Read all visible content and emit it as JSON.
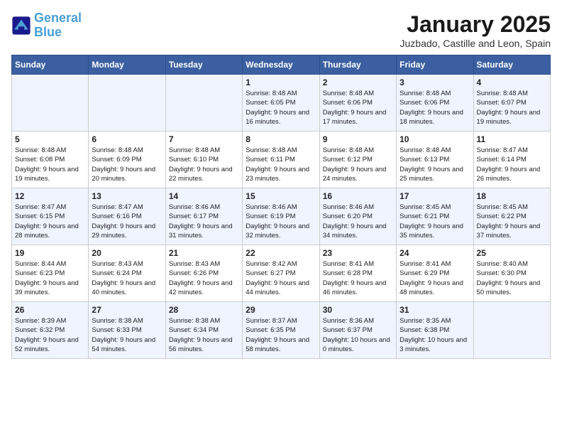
{
  "header": {
    "logo_line1": "General",
    "logo_line2": "Blue",
    "month": "January 2025",
    "location": "Juzbado, Castille and Leon, Spain"
  },
  "weekdays": [
    "Sunday",
    "Monday",
    "Tuesday",
    "Wednesday",
    "Thursday",
    "Friday",
    "Saturday"
  ],
  "weeks": [
    [
      {
        "day": "",
        "info": ""
      },
      {
        "day": "",
        "info": ""
      },
      {
        "day": "",
        "info": ""
      },
      {
        "day": "1",
        "info": "Sunrise: 8:48 AM\nSunset: 6:05 PM\nDaylight: 9 hours and 16 minutes."
      },
      {
        "day": "2",
        "info": "Sunrise: 8:48 AM\nSunset: 6:06 PM\nDaylight: 9 hours and 17 minutes."
      },
      {
        "day": "3",
        "info": "Sunrise: 8:48 AM\nSunset: 6:06 PM\nDaylight: 9 hours and 18 minutes."
      },
      {
        "day": "4",
        "info": "Sunrise: 8:48 AM\nSunset: 6:07 PM\nDaylight: 9 hours and 19 minutes."
      }
    ],
    [
      {
        "day": "5",
        "info": "Sunrise: 8:48 AM\nSunset: 6:08 PM\nDaylight: 9 hours and 19 minutes."
      },
      {
        "day": "6",
        "info": "Sunrise: 8:48 AM\nSunset: 6:09 PM\nDaylight: 9 hours and 20 minutes."
      },
      {
        "day": "7",
        "info": "Sunrise: 8:48 AM\nSunset: 6:10 PM\nDaylight: 9 hours and 22 minutes."
      },
      {
        "day": "8",
        "info": "Sunrise: 8:48 AM\nSunset: 6:11 PM\nDaylight: 9 hours and 23 minutes."
      },
      {
        "day": "9",
        "info": "Sunrise: 8:48 AM\nSunset: 6:12 PM\nDaylight: 9 hours and 24 minutes."
      },
      {
        "day": "10",
        "info": "Sunrise: 8:48 AM\nSunset: 6:13 PM\nDaylight: 9 hours and 25 minutes."
      },
      {
        "day": "11",
        "info": "Sunrise: 8:47 AM\nSunset: 6:14 PM\nDaylight: 9 hours and 26 minutes."
      }
    ],
    [
      {
        "day": "12",
        "info": "Sunrise: 8:47 AM\nSunset: 6:15 PM\nDaylight: 9 hours and 28 minutes."
      },
      {
        "day": "13",
        "info": "Sunrise: 8:47 AM\nSunset: 6:16 PM\nDaylight: 9 hours and 29 minutes."
      },
      {
        "day": "14",
        "info": "Sunrise: 8:46 AM\nSunset: 6:17 PM\nDaylight: 9 hours and 31 minutes."
      },
      {
        "day": "15",
        "info": "Sunrise: 8:46 AM\nSunset: 6:19 PM\nDaylight: 9 hours and 32 minutes."
      },
      {
        "day": "16",
        "info": "Sunrise: 8:46 AM\nSunset: 6:20 PM\nDaylight: 9 hours and 34 minutes."
      },
      {
        "day": "17",
        "info": "Sunrise: 8:45 AM\nSunset: 6:21 PM\nDaylight: 9 hours and 35 minutes."
      },
      {
        "day": "18",
        "info": "Sunrise: 8:45 AM\nSunset: 6:22 PM\nDaylight: 9 hours and 37 minutes."
      }
    ],
    [
      {
        "day": "19",
        "info": "Sunrise: 8:44 AM\nSunset: 6:23 PM\nDaylight: 9 hours and 39 minutes."
      },
      {
        "day": "20",
        "info": "Sunrise: 8:43 AM\nSunset: 6:24 PM\nDaylight: 9 hours and 40 minutes."
      },
      {
        "day": "21",
        "info": "Sunrise: 8:43 AM\nSunset: 6:26 PM\nDaylight: 9 hours and 42 minutes."
      },
      {
        "day": "22",
        "info": "Sunrise: 8:42 AM\nSunset: 6:27 PM\nDaylight: 9 hours and 44 minutes."
      },
      {
        "day": "23",
        "info": "Sunrise: 8:41 AM\nSunset: 6:28 PM\nDaylight: 9 hours and 46 minutes."
      },
      {
        "day": "24",
        "info": "Sunrise: 8:41 AM\nSunset: 6:29 PM\nDaylight: 9 hours and 48 minutes."
      },
      {
        "day": "25",
        "info": "Sunrise: 8:40 AM\nSunset: 6:30 PM\nDaylight: 9 hours and 50 minutes."
      }
    ],
    [
      {
        "day": "26",
        "info": "Sunrise: 8:39 AM\nSunset: 6:32 PM\nDaylight: 9 hours and 52 minutes."
      },
      {
        "day": "27",
        "info": "Sunrise: 8:38 AM\nSunset: 6:33 PM\nDaylight: 9 hours and 54 minutes."
      },
      {
        "day": "28",
        "info": "Sunrise: 8:38 AM\nSunset: 6:34 PM\nDaylight: 9 hours and 56 minutes."
      },
      {
        "day": "29",
        "info": "Sunrise: 8:37 AM\nSunset: 6:35 PM\nDaylight: 9 hours and 58 minutes."
      },
      {
        "day": "30",
        "info": "Sunrise: 8:36 AM\nSunset: 6:37 PM\nDaylight: 10 hours and 0 minutes."
      },
      {
        "day": "31",
        "info": "Sunrise: 8:35 AM\nSunset: 6:38 PM\nDaylight: 10 hours and 3 minutes."
      },
      {
        "day": "",
        "info": ""
      }
    ]
  ]
}
